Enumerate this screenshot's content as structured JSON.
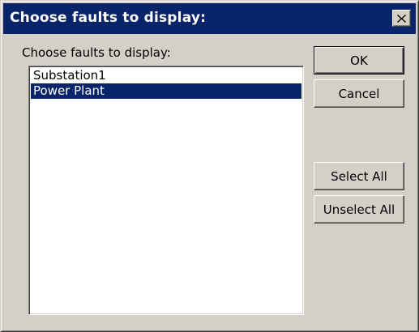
{
  "dialog": {
    "title": "Choose faults to display:",
    "prompt": "Choose faults to display:"
  },
  "titlebar": {
    "close_icon": "close-x-icon",
    "color": "#0a246a"
  },
  "faults_list": {
    "items": [
      {
        "label": "Substation1",
        "selected": false
      },
      {
        "label": "Power Plant",
        "selected": true
      }
    ],
    "selection_color": "#0a246a"
  },
  "buttons": {
    "ok": "OK",
    "cancel": "Cancel",
    "select_all": "Select All",
    "unselect_all": "Unselect All"
  }
}
